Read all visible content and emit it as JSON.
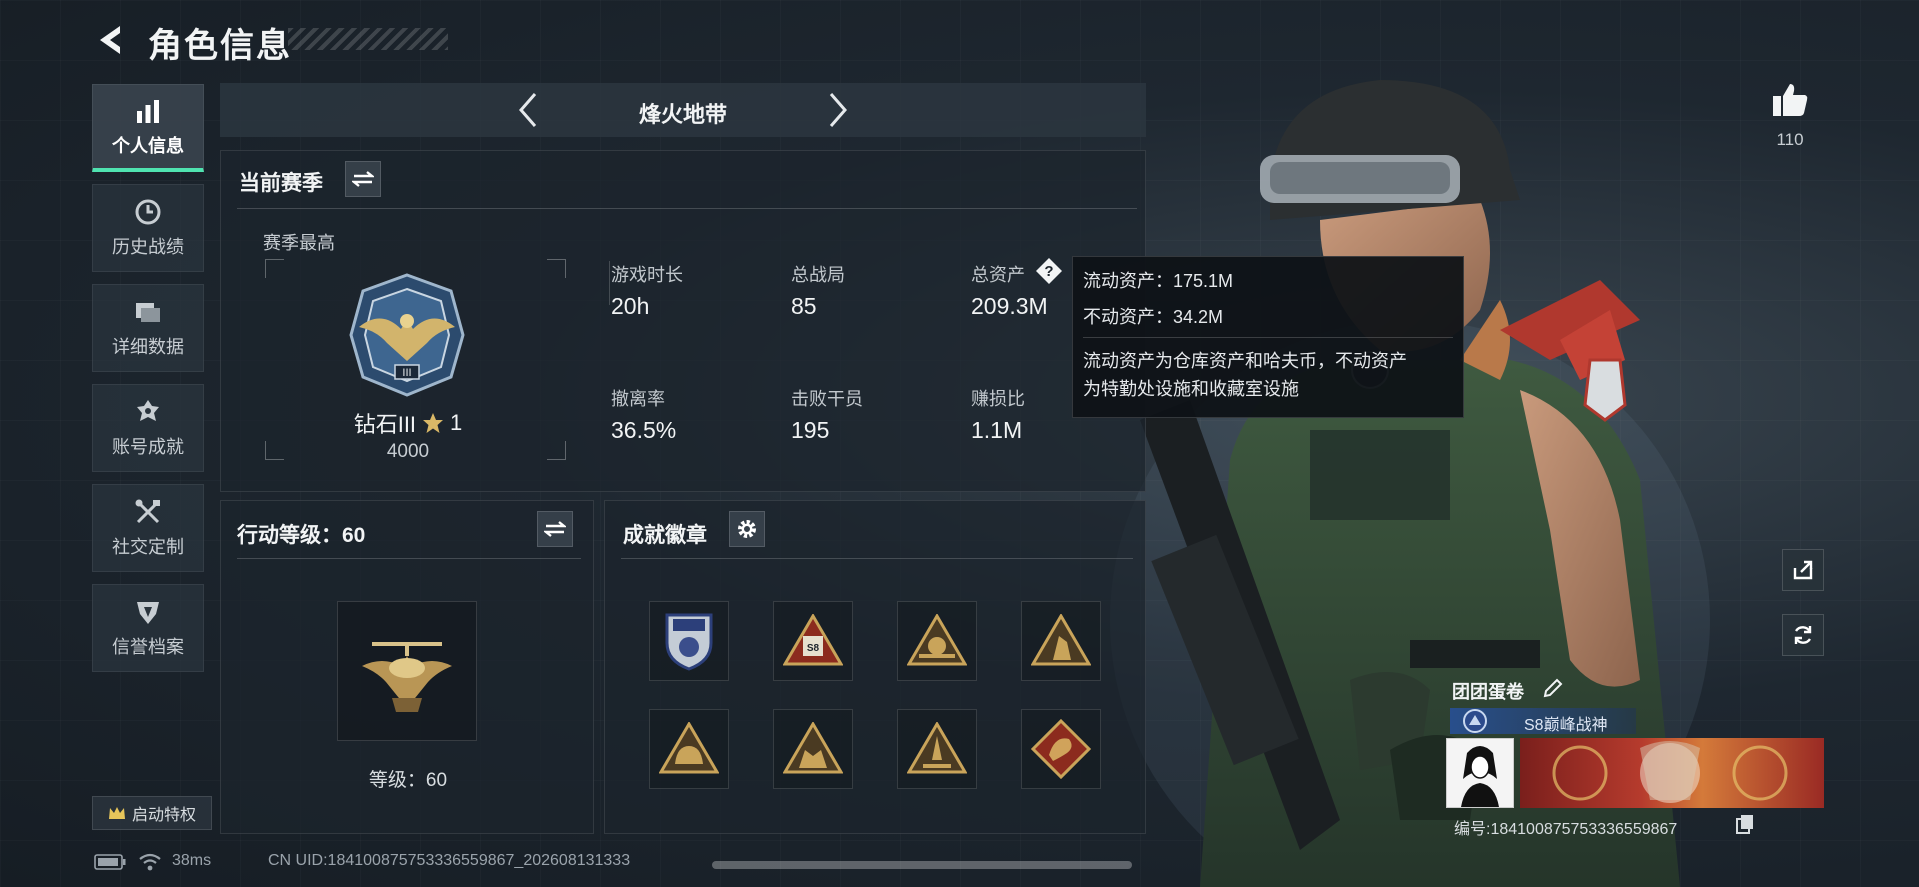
{
  "header": {
    "title": "角色信息"
  },
  "sidebar": {
    "items": [
      {
        "label": "个人信息",
        "icon": "bar-chart-icon",
        "active": true
      },
      {
        "label": "历史战绩",
        "icon": "clock-icon",
        "active": false
      },
      {
        "label": "详细数据",
        "icon": "folder-icon",
        "active": false
      },
      {
        "label": "账号成就",
        "icon": "achievement-icon",
        "active": false
      },
      {
        "label": "社交定制",
        "icon": "tools-icon",
        "active": false
      },
      {
        "label": "信誉档案",
        "icon": "credit-shield-icon",
        "active": false
      }
    ],
    "privilege_label": "启动特权"
  },
  "mode": {
    "name": "烽火地带"
  },
  "season": {
    "title": "当前赛季",
    "best_label": "赛季最高",
    "rank_name": "钻石III",
    "rank_stars": "1",
    "rank_points": "4000",
    "stats": [
      {
        "label": "游戏时长",
        "value": "20h"
      },
      {
        "label": "总战局",
        "value": "85"
      },
      {
        "label": "总资产",
        "value": "209.3M"
      },
      {
        "label": "撤离率",
        "value": "36.5%"
      },
      {
        "label": "击败干员",
        "value": "195"
      },
      {
        "label": "赚损比",
        "value": "1.1M"
      }
    ]
  },
  "tooltip": {
    "line1": "流动资产：175.1M",
    "line2": "不动资产：34.2M",
    "desc1": "流动资产为仓库资产和哈夫币，不动资产",
    "desc2": "为特勤处设施和收藏室设施"
  },
  "action_level": {
    "title": "行动等级：60",
    "level_label": "等级：60"
  },
  "badges": {
    "title": "成就徽章"
  },
  "profile": {
    "likes": "110",
    "name": "团团蛋卷",
    "title": "S8巅峰战神",
    "id_label": "编号:184100875753336559867"
  },
  "status": {
    "ping": "38ms",
    "uid": "CN UID:184100875753336559867_202608131333"
  },
  "colors": {
    "accent": "#4fe3b0",
    "gold": "#c9a45a",
    "panel": "#1c242c"
  }
}
